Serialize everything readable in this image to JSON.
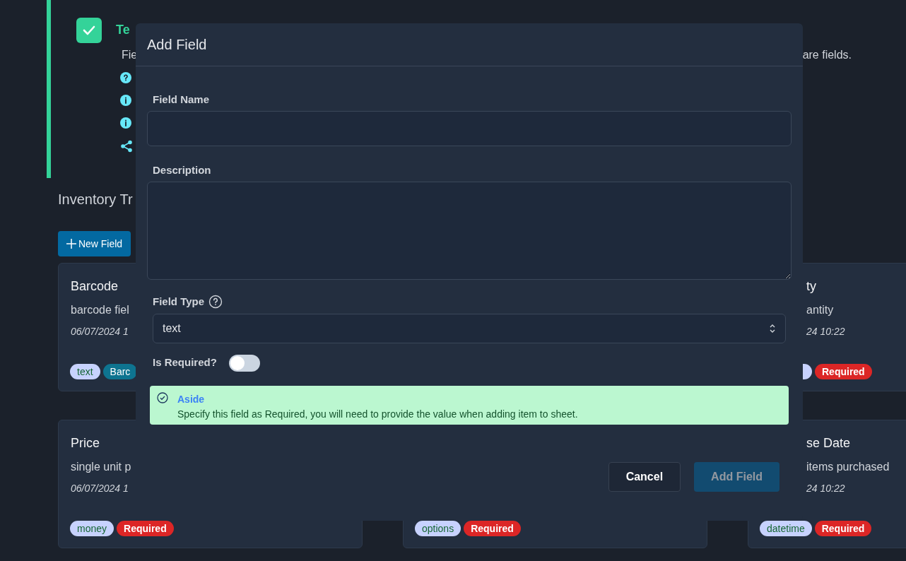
{
  "template": {
    "checked": true,
    "title": "Te",
    "description_start": "Fie",
    "description_end": "are fields."
  },
  "section_title": "Inventory Tr",
  "new_field_button": {
    "label": "New Field"
  },
  "cards": [
    {
      "title": "Barcode",
      "description": "barcode fiel",
      "date": "06/07/2024 1",
      "tags": [
        {
          "kind": "type",
          "label": "text"
        },
        {
          "kind": "name",
          "label": "Barc"
        }
      ]
    },
    {
      "title": "ty",
      "description": "antity",
      "date": "24 10:22",
      "tags": [
        {
          "kind": "type"
        },
        {
          "kind": "required",
          "label": "Required"
        }
      ]
    },
    {
      "title": "Price",
      "description": "single unit p",
      "date": "06/07/2024 1",
      "tags": [
        {
          "kind": "type",
          "label": "money"
        },
        {
          "kind": "required",
          "label": "Required"
        }
      ]
    },
    {
      "tags": [
        {
          "kind": "type",
          "label": "options"
        },
        {
          "kind": "required",
          "label": "Required"
        }
      ]
    },
    {
      "title": "se Date",
      "description": "items purchased",
      "date": "24 10:22",
      "tags": [
        {
          "kind": "type",
          "label": "datetime"
        },
        {
          "kind": "required",
          "label": "Required"
        }
      ]
    }
  ],
  "dialog": {
    "title": "Add Field",
    "fields": [
      {
        "kind": "input",
        "label": "Field Name"
      },
      {
        "kind": "textarea",
        "label": "Description"
      },
      {
        "kind": "select",
        "label": "Field Type",
        "value": "text"
      },
      {
        "kind": "toggle",
        "label": "Is Required?",
        "on": false
      }
    ],
    "aside": {
      "title": "Aside",
      "text": "Specify this field as Required, you will need to provide the value when adding item to sheet."
    },
    "buttons": [
      {
        "kind": "secondary",
        "label": "Cancel",
        "disabled": false
      },
      {
        "kind": "primary",
        "label": "Add Field",
        "disabled": true
      }
    ]
  }
}
